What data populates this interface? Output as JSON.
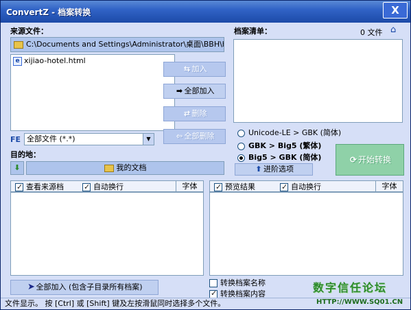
{
  "window": {
    "title": "ConvertZ - 档案转换",
    "close_label": "X"
  },
  "source": {
    "label": "来源文件：",
    "path": "C:\\Documents and Settings\\Administrator\\桌面\\BBH\\hotels",
    "files": [
      "xijiao-hotel.html"
    ],
    "filter_prefix": "FE",
    "filter_value": "全部文件 (*.*)"
  },
  "buttons": {
    "add": "加入",
    "add_all": "全部加入",
    "remove": "删除",
    "remove_all": "全部删除",
    "advanced": "进阶选项",
    "start": "开始转换",
    "add_all_subdirs": "全部加入 (包含子目录所有档案)"
  },
  "queue": {
    "label": "档案清单：",
    "count": "0 文件"
  },
  "conversion": {
    "options": [
      {
        "label": "Unicode-LE > GBK (简体)",
        "selected": false
      },
      {
        "label": "GBK > Big5 (繁体)",
        "selected": false
      },
      {
        "label": "Big5 > GBK (简体)",
        "selected": true
      }
    ]
  },
  "destination": {
    "label": "目的地：",
    "path": "我的文档"
  },
  "left_preview": {
    "view_source_label": "查看来源档",
    "view_source_checked": true,
    "wrap_label": "自动换行",
    "wrap_checked": true,
    "font_label": "字体"
  },
  "right_preview": {
    "preview_label": "预览结果",
    "preview_checked": true,
    "wrap_label": "自动换行",
    "wrap_checked": true,
    "font_label": "字体"
  },
  "options": {
    "convert_names_label": "转换档案名称",
    "convert_names_checked": false,
    "convert_content_label": "转换档案内容",
    "convert_content_checked": true
  },
  "status": {
    "text": "文件显示。   按 [Ctrl] 或 [Shift] 键及左按滑鼠同时选择多个文件。"
  },
  "watermark": {
    "text": "数字信任论坛",
    "url": "HTTP://WWW.SQ01.CN"
  },
  "colors": {
    "title_bar": "#3163c6",
    "window_bg": "#d6dff7",
    "start_button": "#8fd1a8"
  }
}
